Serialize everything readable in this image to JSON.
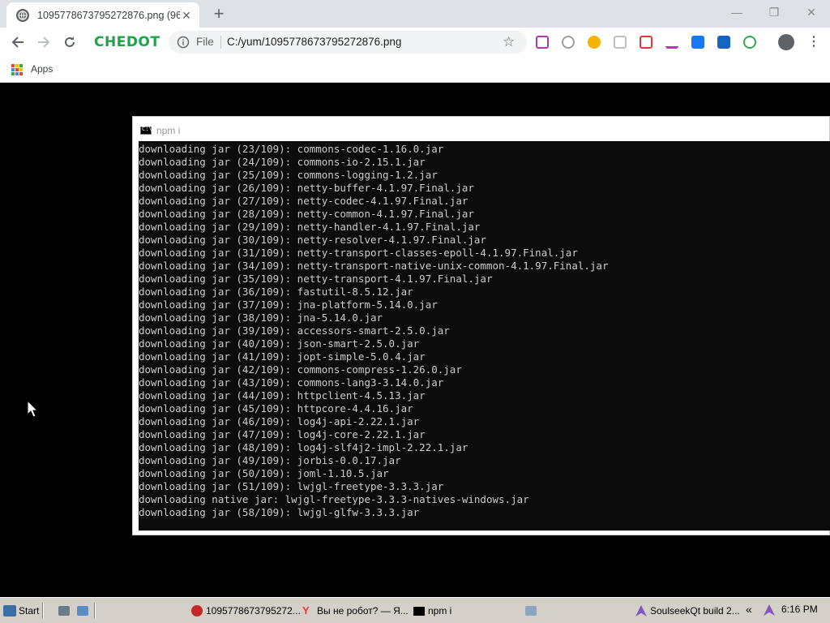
{
  "browser": {
    "tab": {
      "title": "1095778673795272876.png (96×",
      "close": "✕"
    },
    "new_tab": "+",
    "window_controls": {
      "minimize": "—",
      "maximize": "❒",
      "close": "✕"
    },
    "brand": "CHEDOT",
    "address": {
      "scheme": "File",
      "url": "C:/yum/1095778673795272876.png"
    },
    "bookmarks": {
      "apps_label": "Apps"
    },
    "colors": {
      "brand": "#1fa34a",
      "tabstrip": "#dee1e6"
    }
  },
  "console": {
    "title": "npm i",
    "icon_text": "C:\\",
    "lines": [
      "downloading jar (23/109): commons-codec-1.16.0.jar",
      "downloading jar (24/109): commons-io-2.15.1.jar",
      "downloading jar (25/109): commons-logging-1.2.jar",
      "downloading jar (26/109): netty-buffer-4.1.97.Final.jar",
      "downloading jar (27/109): netty-codec-4.1.97.Final.jar",
      "downloading jar (28/109): netty-common-4.1.97.Final.jar",
      "downloading jar (29/109): netty-handler-4.1.97.Final.jar",
      "downloading jar (30/109): netty-resolver-4.1.97.Final.jar",
      "downloading jar (31/109): netty-transport-classes-epoll-4.1.97.Final.jar",
      "downloading jar (34/109): netty-transport-native-unix-common-4.1.97.Final.jar",
      "downloading jar (35/109): netty-transport-4.1.97.Final.jar",
      "downloading jar (36/109): fastutil-8.5.12.jar",
      "downloading jar (37/109): jna-platform-5.14.0.jar",
      "downloading jar (38/109): jna-5.14.0.jar",
      "downloading jar (39/109): accessors-smart-2.5.0.jar",
      "downloading jar (40/109): json-smart-2.5.0.jar",
      "downloading jar (41/109): jopt-simple-5.0.4.jar",
      "downloading jar (42/109): commons-compress-1.26.0.jar",
      "downloading jar (43/109): commons-lang3-3.14.0.jar",
      "downloading jar (44/109): httpclient-4.5.13.jar",
      "downloading jar (45/109): httpcore-4.4.16.jar",
      "downloading jar (46/109): log4j-api-2.22.1.jar",
      "downloading jar (47/109): log4j-core-2.22.1.jar",
      "downloading jar (48/109): log4j-slf4j2-impl-2.22.1.jar",
      "downloading jar (49/109): jorbis-0.0.17.jar",
      "downloading jar (50/109): joml-1.10.5.jar",
      "downloading jar (51/109): lwjgl-freetype-3.3.3.jar",
      "downloading native jar: lwjgl-freetype-3.3.3-natives-windows.jar",
      "downloading jar (58/109): lwjgl-glfw-3.3.3.jar"
    ]
  },
  "taskbar": {
    "start_label": "Start",
    "tasks": [
      {
        "label": "1095778673795272...",
        "icon": "chedot-icon"
      },
      {
        "label": "Вы не робот? — Я...",
        "icon": "yandex-icon"
      },
      {
        "label": "npm i",
        "icon": "cmd-icon"
      },
      {
        "label": "SoulseekQt build 2...",
        "icon": "soulseek-icon"
      }
    ],
    "overflow": "«",
    "clock": "6:16 PM"
  }
}
